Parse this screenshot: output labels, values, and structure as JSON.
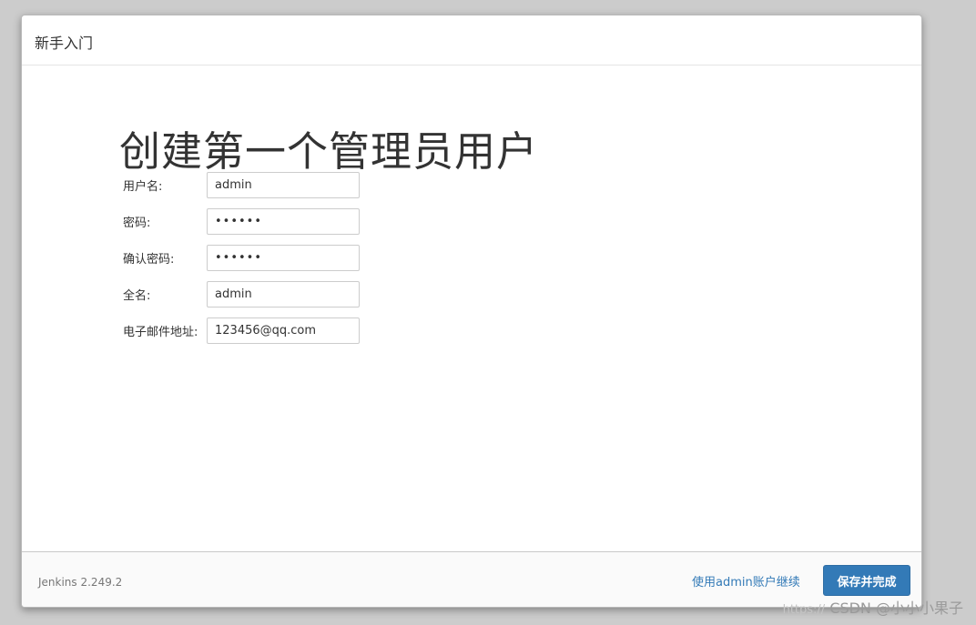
{
  "dialog": {
    "title": "新手入门"
  },
  "page": {
    "heading": "创建第一个管理员用户"
  },
  "form": {
    "username": {
      "label": "用户名:",
      "value": "admin"
    },
    "password": {
      "label": "密码:",
      "value": "••••••"
    },
    "confirm_password": {
      "label": "确认密码:",
      "value": "••••••"
    },
    "full_name": {
      "label": "全名:",
      "value": "admin"
    },
    "email": {
      "label": "电子邮件地址:",
      "value": "123456@qq.com"
    }
  },
  "footer": {
    "version": "Jenkins 2.249.2",
    "continue_link": "使用admin账户继续",
    "save_button": "保存并完成"
  },
  "watermark": {
    "url": "https://",
    "text": "CSDN @小小小果子"
  },
  "colors": {
    "primary": "#337ab7",
    "backdrop": "#cccccc"
  }
}
